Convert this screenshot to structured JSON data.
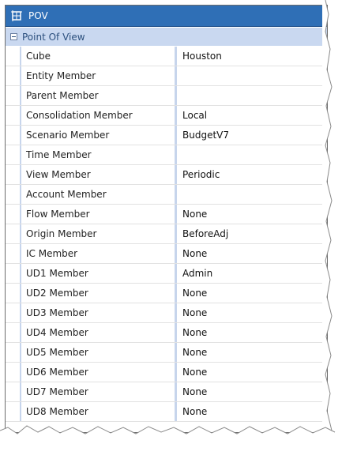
{
  "panel": {
    "title": "POV",
    "icon": "pov-grid-icon",
    "section": {
      "label": "Point Of View",
      "expanded": true
    },
    "rows": [
      {
        "label": "Cube",
        "value": "Houston"
      },
      {
        "label": "Entity Member",
        "value": ""
      },
      {
        "label": "Parent Member",
        "value": ""
      },
      {
        "label": "Consolidation Member",
        "value": "Local"
      },
      {
        "label": "Scenario Member",
        "value": "BudgetV7"
      },
      {
        "label": "Time Member",
        "value": ""
      },
      {
        "label": "View Member",
        "value": "Periodic"
      },
      {
        "label": "Account Member",
        "value": ""
      },
      {
        "label": "Flow Member",
        "value": "None"
      },
      {
        "label": "Origin Member",
        "value": "BeforeAdj"
      },
      {
        "label": "IC Member",
        "value": "None"
      },
      {
        "label": "UD1 Member",
        "value": "Admin"
      },
      {
        "label": "UD2 Member",
        "value": "None"
      },
      {
        "label": "UD3 Member",
        "value": "None"
      },
      {
        "label": "UD4 Member",
        "value": "None"
      },
      {
        "label": "UD5 Member",
        "value": "None"
      },
      {
        "label": "UD6 Member",
        "value": "None"
      },
      {
        "label": "UD7 Member",
        "value": "None"
      },
      {
        "label": "UD8 Member",
        "value": "None"
      }
    ]
  },
  "colors": {
    "titlebar": "#2f6fb6",
    "section_bg": "#c9d8f0",
    "divider": "#c7d5ec"
  }
}
